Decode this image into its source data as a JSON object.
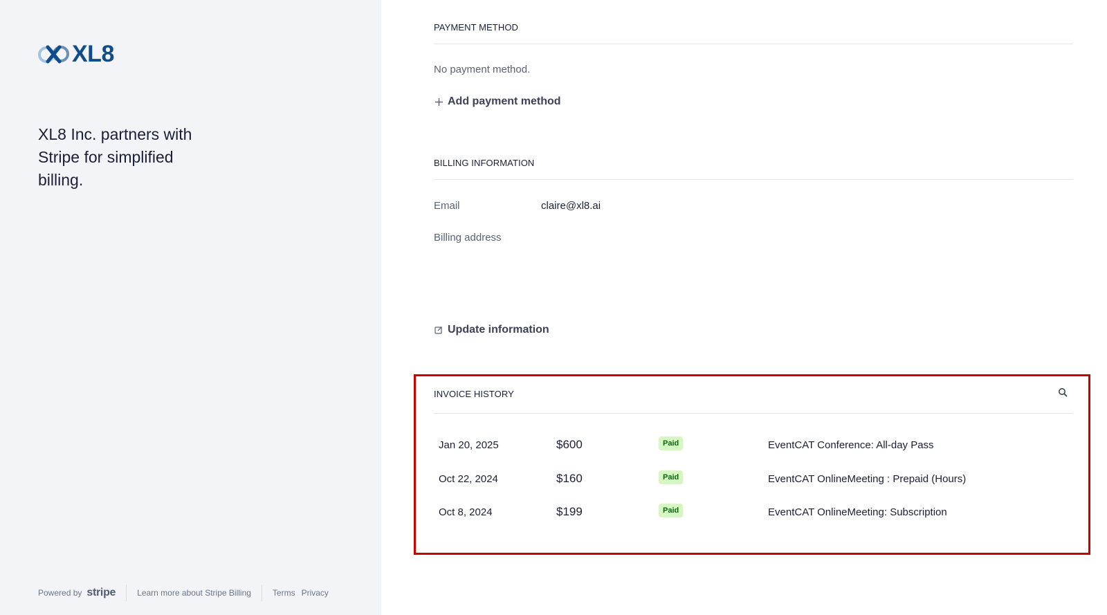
{
  "brand": {
    "name": "XL8",
    "tagline": "XL8 Inc. partners with Stripe for simplified billing.",
    "color": "#0f4c8a"
  },
  "footer": {
    "powered_by": "Powered by",
    "stripe_word": "stripe",
    "learn_more": "Learn more about Stripe Billing",
    "terms": "Terms",
    "privacy": "Privacy"
  },
  "payment_method": {
    "title": "PAYMENT METHOD",
    "empty_text": "No payment method.",
    "add_label": "Add payment method",
    "add_icon": "plus-icon"
  },
  "billing_information": {
    "title": "BILLING INFORMATION",
    "email_label": "Email",
    "email_value": "claire@xl8.ai",
    "address_label": "Billing address",
    "update_label": "Update information",
    "update_icon": "edit-icon"
  },
  "invoice_history": {
    "title": "INVOICE HISTORY",
    "search_icon": "search-icon",
    "highlight_color": "#cc0000",
    "rows": [
      {
        "date": "Jan 20, 2025",
        "amount": "$600",
        "status": "Paid",
        "description": "EventCAT Conference: All-day Pass"
      },
      {
        "date": "Oct 22, 2024",
        "amount": "$160",
        "status": "Paid",
        "description": "EventCAT OnlineMeeting : Prepaid (Hours)"
      },
      {
        "date": "Oct 8, 2024",
        "amount": "$199",
        "status": "Paid",
        "description": "EventCAT OnlineMeeting: Subscription"
      }
    ]
  }
}
